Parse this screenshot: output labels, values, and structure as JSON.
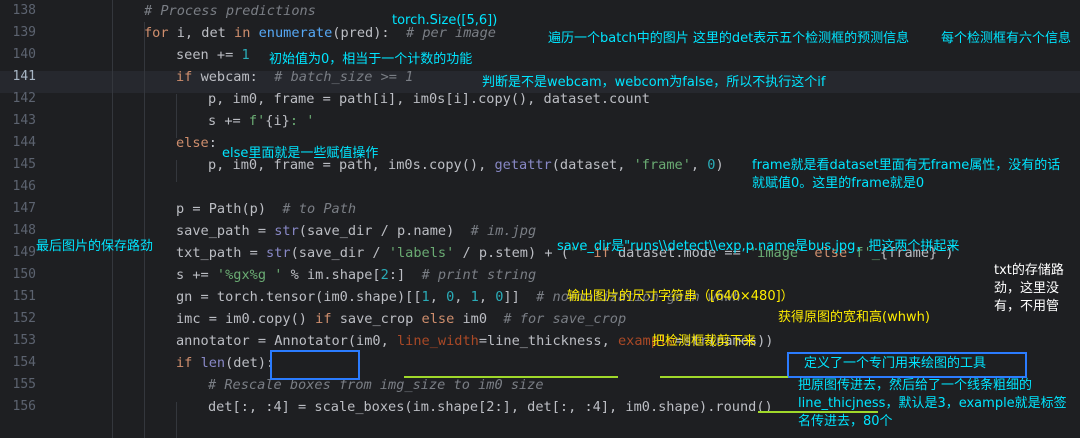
{
  "editor": {
    "line_numbers": [
      "138",
      "139",
      "140",
      "141",
      "142",
      "143",
      "144",
      "145",
      "146",
      "147",
      "148",
      "149",
      "150",
      "151",
      "152",
      "153",
      "154",
      "155",
      "156"
    ],
    "current_line": "141",
    "lines": {
      "l138": [
        [
          "cmt",
          "# Process predictions"
        ]
      ],
      "l139": [
        [
          "kw",
          "for "
        ],
        [
          "",
          "i, det "
        ],
        [
          "kw",
          "in "
        ],
        [
          "fn",
          "enumerate"
        ],
        [
          "",
          "(pred):  "
        ],
        [
          "cmt",
          "# per image"
        ]
      ],
      "l140": [
        [
          "",
          "seen += "
        ],
        [
          "num",
          "1"
        ]
      ],
      "l141": [
        [
          "kw",
          "if "
        ],
        [
          "",
          "webcam:  "
        ],
        [
          "cmt",
          "# batch_size >= 1"
        ]
      ],
      "l142": [
        [
          "",
          "p, im0, frame = path[i], im0s[i].copy(), dataset.count"
        ]
      ],
      "l143": [
        [
          "",
          "s += "
        ],
        [
          "str",
          "f'"
        ],
        [
          "",
          "{i}"
        ],
        [
          "str",
          ": '"
        ]
      ],
      "l144": [
        [
          "kw",
          "else"
        ],
        [
          "",
          ":"
        ]
      ],
      "l145": [
        [
          "",
          "p, im0, frame = path, im0s.copy(), "
        ],
        [
          "bi",
          "getattr"
        ],
        [
          "",
          "(dataset, "
        ],
        [
          "str",
          "'frame'"
        ],
        [
          "",
          ", "
        ],
        [
          "num",
          "0"
        ],
        [
          "",
          ")"
        ]
      ],
      "l146": [],
      "l147": [
        [
          "",
          "p = Path(p)  "
        ],
        [
          "cmt",
          "# to Path"
        ]
      ],
      "l148": [
        [
          "",
          "save_path = "
        ],
        [
          "bi",
          "str"
        ],
        [
          "",
          "(save_dir / p.name)  "
        ],
        [
          "cmt",
          "# im.jpg"
        ]
      ],
      "l149": [
        [
          "",
          "txt_path = "
        ],
        [
          "bi",
          "str"
        ],
        [
          "",
          "(save_dir / "
        ],
        [
          "str",
          "'labels'"
        ],
        [
          "",
          " / p.stem) + ("
        ],
        [
          "str",
          "''"
        ],
        [
          "kw",
          " if "
        ],
        [
          "",
          "dataset.mode == "
        ],
        [
          "str",
          "'image'"
        ],
        [
          "kw",
          " else "
        ],
        [
          "str",
          "f'_"
        ],
        [
          "",
          "{frame}"
        ],
        [
          "str",
          "'"
        ],
        [
          "",
          ")"
        ]
      ],
      "l150": [
        [
          "",
          "s += "
        ],
        [
          "str",
          "'%gx%g '"
        ],
        [
          "",
          " % im.shape["
        ],
        [
          "num",
          "2"
        ],
        [
          "",
          ":]  "
        ],
        [
          "cmt",
          "# print string"
        ]
      ],
      "l151": [
        [
          "",
          "gn = torch.tensor(im0.shape)[["
        ],
        [
          "num",
          "1"
        ],
        [
          "",
          ", "
        ],
        [
          "num",
          "0"
        ],
        [
          "",
          ", "
        ],
        [
          "num",
          "1"
        ],
        [
          "",
          ", "
        ],
        [
          "num",
          "0"
        ],
        [
          "",
          "]]  "
        ],
        [
          "cmt",
          "# normalization gain whwh"
        ]
      ],
      "l152": [
        [
          "",
          "imc = im0.copy() "
        ],
        [
          "kw",
          "if "
        ],
        [
          "",
          "save_crop "
        ],
        [
          "kw",
          "else "
        ],
        [
          "",
          "im0  "
        ],
        [
          "cmt",
          "# for save_crop"
        ]
      ],
      "l153": [
        [
          "",
          "annotator = Annotator(im0, "
        ],
        [
          "kwa",
          "line_width"
        ],
        [
          "",
          "=line_thickness, "
        ],
        [
          "kwa",
          "example"
        ],
        [
          "",
          "="
        ],
        [
          "bi",
          "str"
        ],
        [
          "",
          "(names))"
        ]
      ],
      "l154": [
        [
          "kw",
          "if "
        ],
        [
          "bi",
          "len"
        ],
        [
          "",
          "(det):"
        ]
      ],
      "l155": [
        [
          "cmt",
          "# Rescale boxes from img_size to im0 size"
        ]
      ],
      "l156": [
        [
          "",
          "det[:, :4] = scale_boxes(im.shape[2:], det[:, :4], im0.shape).round()"
        ]
      ]
    }
  },
  "annotations": {
    "torch_size": "torch.Size([5,6])",
    "loop_batch": "遍历一个batch中的图片 这里的det表示五个检测框的预测信息",
    "six_info": "每个检测框有六个信息",
    "seen_init": "初始值为0，相当于一个计数的功能",
    "webcam_check": "判断是不是webcam，webcom为false，所以不执行这个if",
    "else_assign": "else里面就是一些赋值操作",
    "frame_attr": "frame就是看dataset里面有无frame属性，没有的话就赋值0。这里的frame就是0",
    "save_path_label": "最后图片的保存路劲",
    "save_dir_note": "save_dir是\"runs\\\\detect\\\\exp,p.name是bus.jpg，把这两个拼起来",
    "txt_path_note": "txt的存储路劲，这里没有，不用管",
    "print_size": "输出图片的尺寸字符串（[640×480]）",
    "gn_note": "获得原图的宽和高(whwh)",
    "crop_note": "把检测框裁剪下来",
    "annotator_tool": "定义了一个专门用来绘图的工具",
    "annotator_detail": "把原图传进去，然后给了一个线条粗细的line_thicjness，默认是3，example就是标签名传进去，80个"
  }
}
